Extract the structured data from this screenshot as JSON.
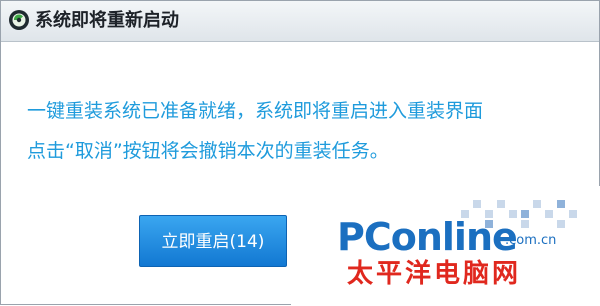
{
  "window": {
    "title": "系统即将重新启动",
    "icon": "app-logo-icon"
  },
  "message": {
    "line1": "一键重装系统已准备就绪，系统即将重启进入重装界面",
    "line2": "点击“取消”按钮将会撤销本次的重装任务。"
  },
  "actions": {
    "restart_label": "立即重启(14)"
  },
  "watermark": {
    "logo_text": "PConline",
    "domain": ".com.cn",
    "cn_name": "太平洋电脑网"
  },
  "colors": {
    "message_text": "#1f9bdc",
    "button_bg": "#1a86dc",
    "watermark_blue": "#1b6fc0",
    "watermark_red": "#e0281e"
  }
}
